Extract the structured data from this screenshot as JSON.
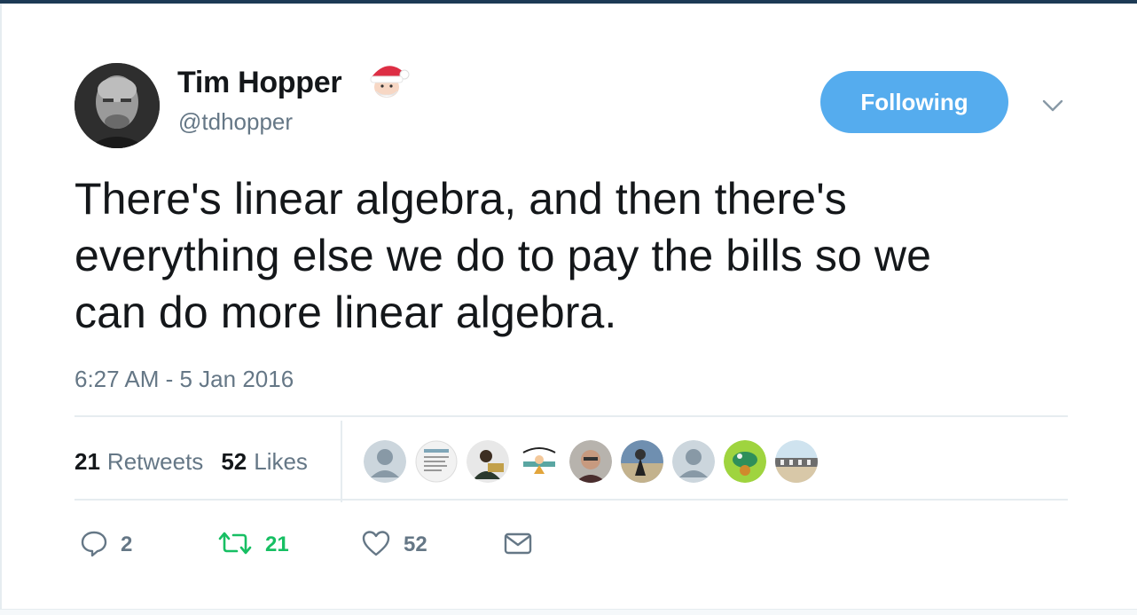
{
  "author": {
    "name": "Tim Hopper",
    "handle": "@tdhopper",
    "emoji_icon": "santa-emoji-icon",
    "avatar_icon": "profile-photo"
  },
  "follow_button": {
    "label": "Following",
    "color": "#55acee"
  },
  "menu": {
    "icon": "chevron-down-icon"
  },
  "tweet": {
    "text": "There's linear algebra, and then there's\neverything else we do to pay the bills so we\ncan do more linear algebra.",
    "timestamp": "6:27 AM - 5 Jan 2016"
  },
  "stats": {
    "retweets_count": "21",
    "retweets_label": "Retweets",
    "likes_count": "52",
    "likes_label": "Likes"
  },
  "likers": [
    {
      "icon": "default-avatar"
    },
    {
      "icon": "document-avatar"
    },
    {
      "icon": "photo-avatar"
    },
    {
      "icon": "cartoon-avatar"
    },
    {
      "icon": "photo-avatar"
    },
    {
      "icon": "photo-avatar"
    },
    {
      "icon": "default-avatar"
    },
    {
      "icon": "photo-avatar"
    },
    {
      "icon": "photo-avatar"
    }
  ],
  "actions": {
    "reply_count": "2",
    "retweet_count": "21",
    "like_count": "52",
    "reply_icon": "reply-icon",
    "retweet_icon": "retweet-icon",
    "like_icon": "heart-icon",
    "dm_icon": "envelope-icon",
    "retweet_color": "#17bf63"
  }
}
